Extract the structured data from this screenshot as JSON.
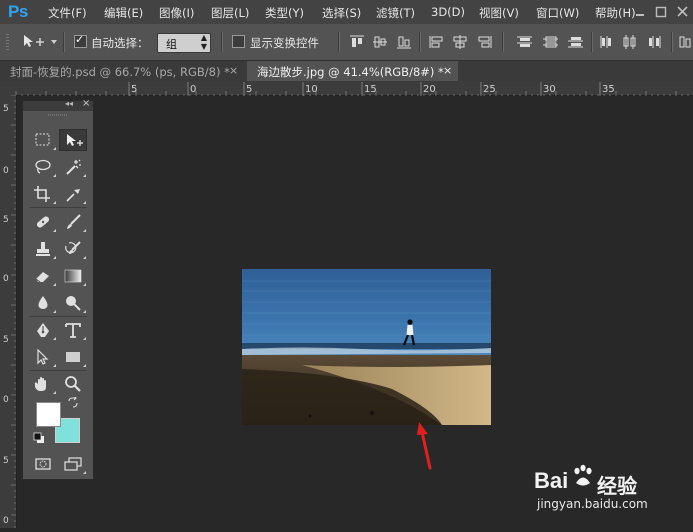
{
  "app": {
    "logo": "Ps"
  },
  "menu": [
    "文件(F)",
    "编辑(E)",
    "图像(I)",
    "图层(L)",
    "类型(Y)",
    "选择(S)",
    "滤镜(T)",
    "3D(D)",
    "视图(V)",
    "窗口(W)",
    "帮助(H)"
  ],
  "options": {
    "auto_select_label": "自动选择：",
    "auto_select_checked": true,
    "auto_select_value": "组",
    "show_transform_label": "显示变换控件",
    "show_transform_checked": false
  },
  "tabs": [
    {
      "label": "封面-恢复的.psd @ 66.7% (ps, RGB/8) *",
      "close": "×",
      "active": false
    },
    {
      "label": "海边散步.jpg @ 41.4%(RGB/8#) *",
      "close": "×",
      "active": true
    }
  ],
  "ruler": {
    "h_labels": [
      "5",
      "0",
      "5",
      "10",
      "15",
      "20",
      "25",
      "30",
      "35"
    ],
    "v_labels": [
      "5",
      "0",
      "5",
      "0",
      "5",
      "0",
      "5",
      "0",
      "5"
    ]
  },
  "panel": {
    "collapse": "◂◂",
    "close": "×"
  },
  "colors": {
    "foreground": "#ffffff",
    "background": "#7fe0dc",
    "accent": "#2fa3f6",
    "arrow": "#e0201e"
  },
  "watermark": {
    "brand": "Bai",
    "brand_suffix": "经验",
    "url": "jingyan.baidu.com"
  }
}
